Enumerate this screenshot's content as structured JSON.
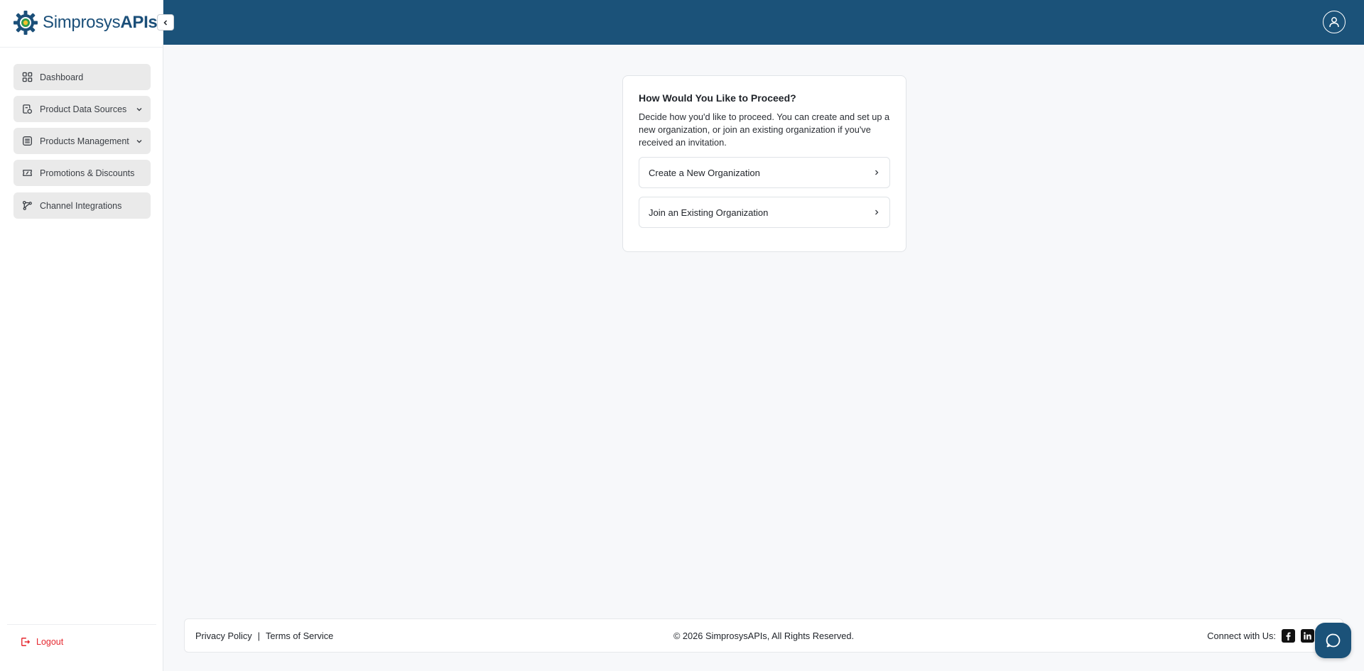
{
  "brand": {
    "name_regular": "Simprosys",
    "name_bold": "APIs",
    "brand_color": "#1b4f79",
    "header_color": "#1b5279"
  },
  "sidebar": {
    "items": [
      {
        "label": "Dashboard",
        "icon": "dashboard-grid-icon",
        "expandable": false
      },
      {
        "label": "Product Data Sources",
        "icon": "data-source-icon",
        "expandable": true
      },
      {
        "label": "Products Management",
        "icon": "list-box-icon",
        "expandable": true
      },
      {
        "label": "Promotions & Discounts",
        "icon": "ticket-icon",
        "expandable": false
      },
      {
        "label": "Channel Integrations",
        "icon": "integration-icon",
        "expandable": false
      }
    ],
    "logout_label": "Logout",
    "logout_color": "#e5282f"
  },
  "card": {
    "title": "How Would You Like to Proceed?",
    "description": "Decide how you'd like to proceed. You can create and set up a new organization, or join an existing organization if you've received an invitation.",
    "options": [
      {
        "label": "Create a New Organization"
      },
      {
        "label": "Join an Existing Organization"
      }
    ]
  },
  "footer": {
    "privacy": "Privacy Policy",
    "separator": "|",
    "terms": "Terms of Service",
    "copyright": "© 2026 SimprosysAPIs, All Rights Reserved.",
    "connect": "Connect with Us:"
  }
}
